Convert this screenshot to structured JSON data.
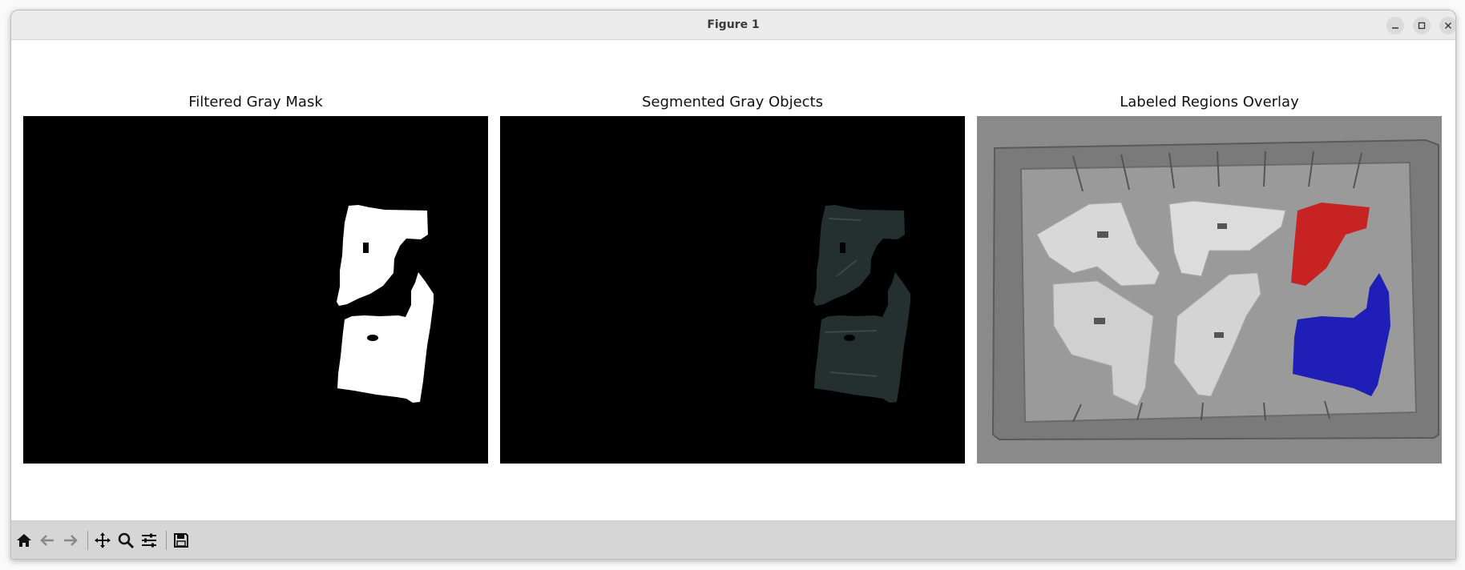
{
  "window": {
    "title": "Figure 1",
    "controls": [
      "minimize-icon",
      "maximize-icon",
      "close-icon"
    ]
  },
  "figure": {
    "panels": [
      {
        "title": "Filtered Gray Mask"
      },
      {
        "title": "Segmented Gray Objects"
      },
      {
        "title": "Labeled Regions Overlay"
      }
    ]
  },
  "toolbar": {
    "tools": [
      "home-icon",
      "back-arrow-icon",
      "forward-arrow-icon",
      "pan-icon",
      "zoom-icon",
      "configure-subplots-icon",
      "save-icon"
    ]
  },
  "colors": {
    "mask_fill": "#ffffff",
    "segmented_fill": "#24302f",
    "overlay_red": "#c72323",
    "overlay_blue": "#1f1fb8",
    "tray_gray": "#7a7a7a"
  }
}
